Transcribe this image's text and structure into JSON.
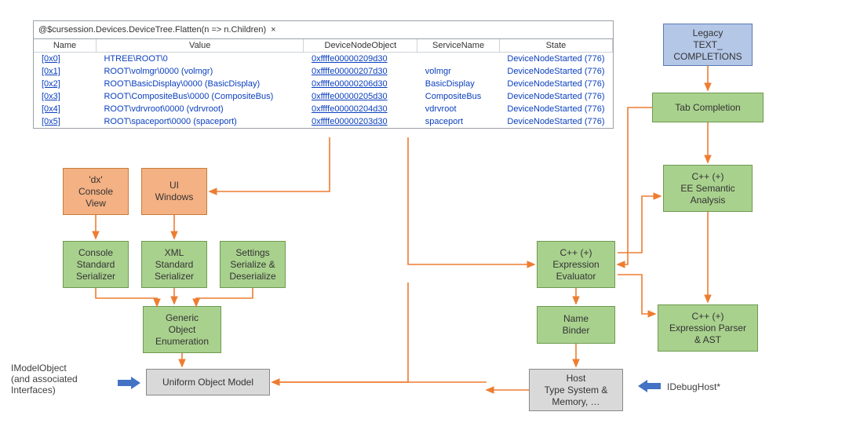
{
  "watch": {
    "expression": "@$cursession.Devices.DeviceTree.Flatten(n => n.Children)",
    "close_glyph": "×",
    "columns": [
      "Name",
      "Value",
      "DeviceNodeObject",
      "ServiceName",
      "State"
    ],
    "rows": [
      {
        "name": "[0x0]",
        "value": "HTREE\\ROOT\\0",
        "obj": "0xffffe00000209d30",
        "svc": "",
        "state": "DeviceNodeStarted (776)"
      },
      {
        "name": "[0x1]",
        "value": "ROOT\\volmgr\\0000 (volmgr)",
        "obj": "0xffffe00000207d30",
        "svc": "volmgr",
        "state": "DeviceNodeStarted (776)"
      },
      {
        "name": "[0x2]",
        "value": "ROOT\\BasicDisplay\\0000 (BasicDisplay)",
        "obj": "0xffffe00000206d30",
        "svc": "BasicDisplay",
        "state": "DeviceNodeStarted (776)"
      },
      {
        "name": "[0x3]",
        "value": "ROOT\\CompositeBus\\0000 (CompositeBus)",
        "obj": "0xffffe00000205d30",
        "svc": "CompositeBus",
        "state": "DeviceNodeStarted (776)"
      },
      {
        "name": "[0x4]",
        "value": "ROOT\\vdrvroot\\0000 (vdrvroot)",
        "obj": "0xffffe00000204d30",
        "svc": "vdrvroot",
        "state": "DeviceNodeStarted (776)"
      },
      {
        "name": "[0x5]",
        "value": "ROOT\\spaceport\\0000 (spaceport)",
        "obj": "0xffffe00000203d30",
        "svc": "spaceport",
        "state": "DeviceNodeStarted (776)"
      }
    ]
  },
  "nodes": {
    "dx_console": "'dx'\nConsole\nView",
    "ui_windows": "UI\nWindows",
    "console_serializer": "Console\nStandard\nSerializer",
    "xml_serializer": "XML\nStandard\nSerializer",
    "settings_serialize": "Settings\nSerialize &\nDeserialize",
    "generic_enum": "Generic\nObject\nEnumeration",
    "uniform_model": "Uniform Object Model",
    "legacy": "Legacy\nTEXT_\nCOMPLETIONS",
    "tab_completion": "Tab Completion",
    "ee_semantic": "C++ (+)\nEE Semantic\nAnalysis",
    "expr_eval": "C++ (+)\nExpression\nEvaluator",
    "name_binder": "Name\nBinder",
    "expr_parser": "C++ (+)\nExpression Parser\n& AST",
    "host_typesys": "Host\nType System &\nMemory, …"
  },
  "annotations": {
    "imodel": "IModelObject\n(and associated\nInterfaces)",
    "idebughost": "IDebugHost*"
  }
}
